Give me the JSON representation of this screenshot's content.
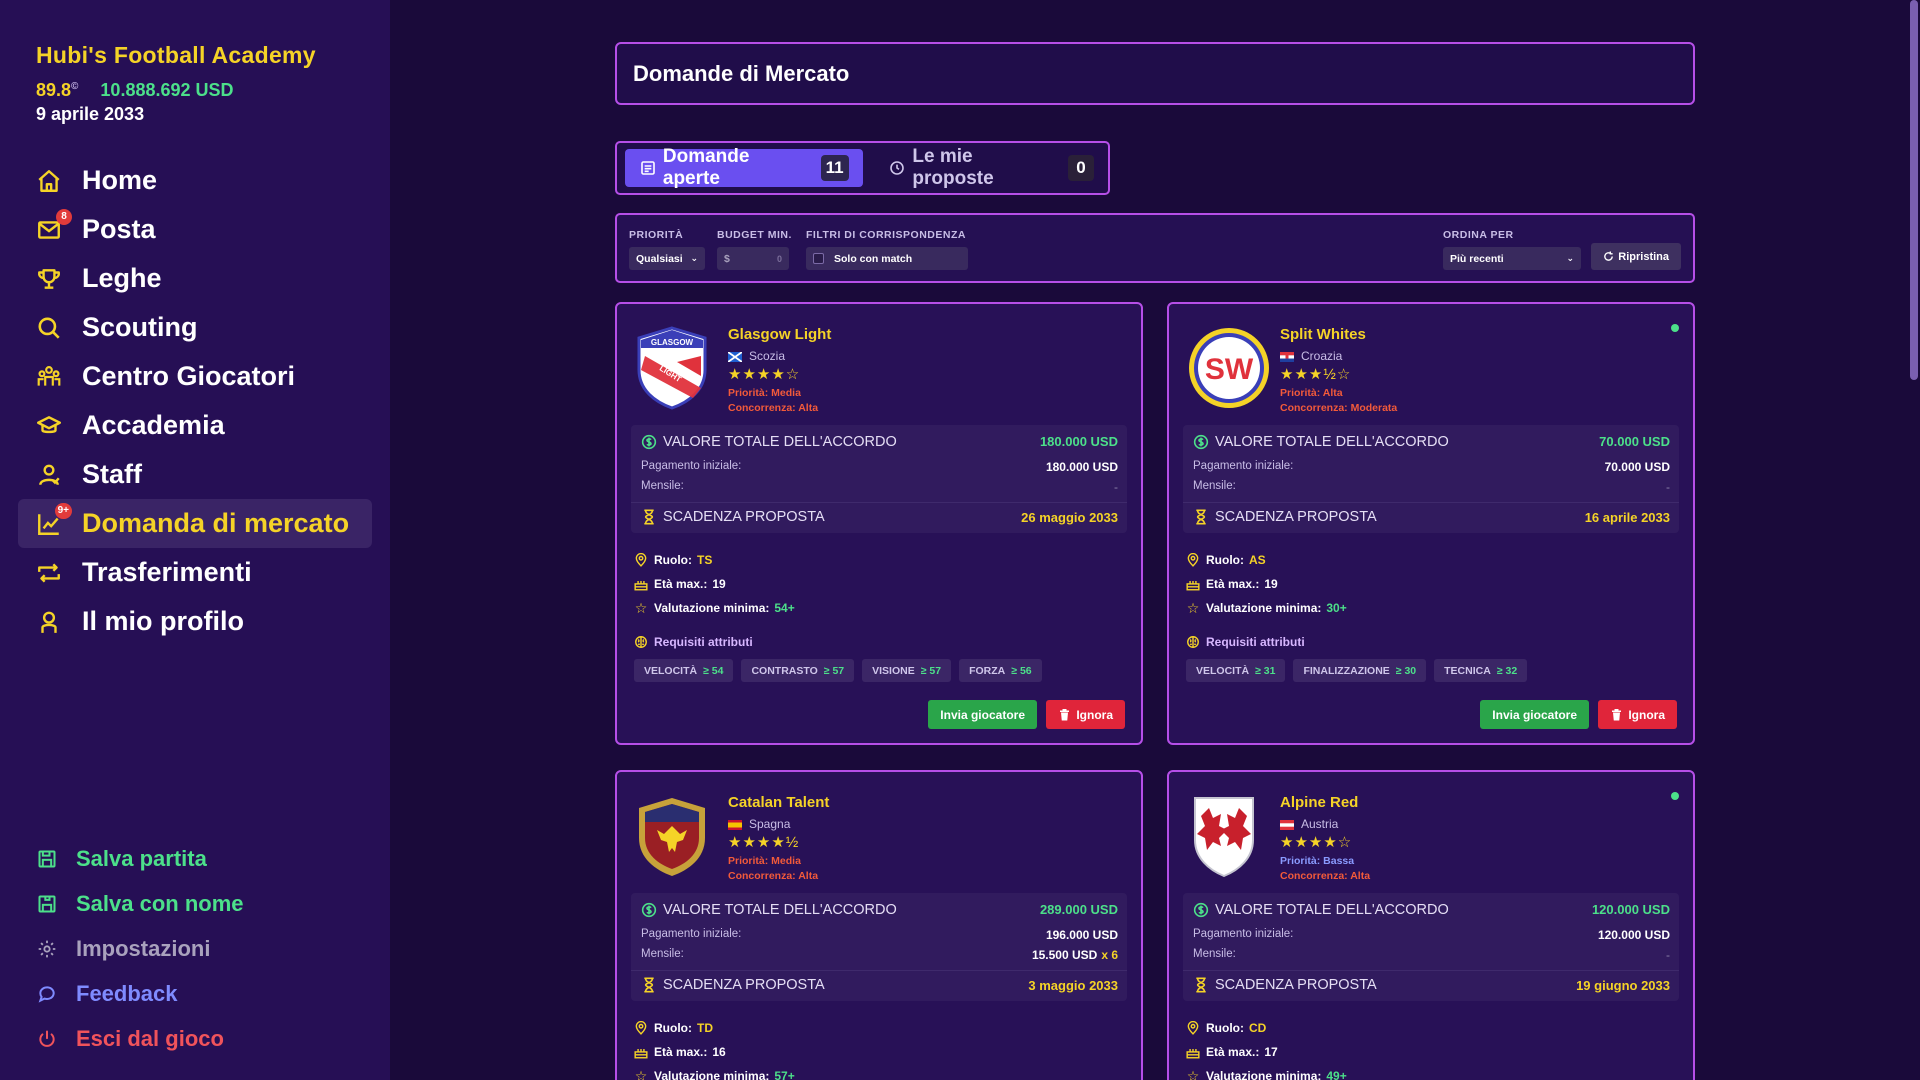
{
  "app": {
    "club_name": "Hubi's Football Academy",
    "rating": "89.8",
    "rating_symbol": "©",
    "balance": "10.888.692 USD",
    "date": "9 aprile 2033"
  },
  "nav": {
    "items": [
      {
        "label": "Home",
        "icon": "home-icon"
      },
      {
        "label": "Posta",
        "icon": "mail-icon",
        "badge": "8"
      },
      {
        "label": "Leghe",
        "icon": "trophy-icon"
      },
      {
        "label": "Scouting",
        "icon": "search-icon"
      },
      {
        "label": "Centro Giocatori",
        "icon": "players-icon"
      },
      {
        "label": "Accademia",
        "icon": "graduation-cap-icon"
      },
      {
        "label": "Staff",
        "icon": "staff-icon"
      },
      {
        "label": "Domanda di mercato",
        "icon": "chart-icon",
        "badge": "9+",
        "active": true
      },
      {
        "label": "Trasferimenti",
        "icon": "transfer-icon"
      },
      {
        "label": "Il mio profilo",
        "icon": "user-icon"
      }
    ],
    "bottom": [
      {
        "label": "Salva partita",
        "icon": "save-icon"
      },
      {
        "label": "Salva con nome",
        "icon": "save-as-icon"
      },
      {
        "label": "Impostazioni",
        "icon": "gear-icon"
      },
      {
        "label": "Feedback",
        "icon": "chat-bubble-icon"
      },
      {
        "label": "Esci dal gioco",
        "icon": "power-icon"
      }
    ]
  },
  "page": {
    "title": "Domande di Mercato"
  },
  "tabs": [
    {
      "label": "Domande aperte",
      "count": "11",
      "icon": "list-icon"
    },
    {
      "label": "Le mie proposte",
      "count": "0",
      "icon": "clock-icon"
    }
  ],
  "filters": {
    "priority_label": "PRIORITÀ",
    "priority_value": "Qualsiasi",
    "budget_label": "BUDGET MIN.",
    "budget_prefix": "$",
    "budget_placeholder": "0",
    "match_label": "FILTRI DI CORRISPONDENZA",
    "match_value": "Solo con match",
    "sort_label": "ORDINA PER",
    "sort_value": "Più recenti",
    "reset_label": "Ripristina"
  },
  "labels": {
    "deal_total": "VALORE TOTALE DELL'ACCORDO",
    "upfront": "Pagamento iniziale:",
    "monthly": "Mensile:",
    "deadline": "SCADENZA PROPOSTA",
    "role": "Ruolo:",
    "max_age": "Età max.:",
    "min_rating": "Valutazione minima:",
    "attr_req": "Requisiti attributi",
    "send": "Invia giocatore",
    "ignore": "Ignora"
  },
  "offers": [
    {
      "club": "Glasgow Light",
      "country": "Scozia",
      "stars": "★★★★☆",
      "priority": "Priorità: Media",
      "competition": "Concorrenza: Alta",
      "total": "180.000 USD",
      "upfront": "180.000 USD",
      "monthly": "-",
      "deadline": "26 maggio 2033",
      "role": "TS",
      "max_age": "19",
      "min_rating": "54+",
      "attrs": [
        {
          "name": "VELOCITÀ",
          "min": "≥ 54"
        },
        {
          "name": "CONTRASTO",
          "min": "≥ 57"
        },
        {
          "name": "VISIONE",
          "min": "≥ 57"
        },
        {
          "name": "FORZA",
          "min": "≥ 56"
        }
      ],
      "online": false,
      "crest_text_top": "GLASGOW",
      "crest_text_diag": "LIGHT"
    },
    {
      "club": "Split Whites",
      "country": "Croazia",
      "stars": "★★★½☆",
      "priority": "Priorità: Alta",
      "competition": "Concorrenza: Moderata",
      "total": "70.000 USD",
      "upfront": "70.000 USD",
      "monthly": "-",
      "deadline": "16 aprile 2033",
      "role": "AS",
      "max_age": "19",
      "min_rating": "30+",
      "attrs": [
        {
          "name": "VELOCITÀ",
          "min": "≥ 31"
        },
        {
          "name": "FINALIZZAZIONE",
          "min": "≥ 30"
        },
        {
          "name": "TECNICA",
          "min": "≥ 32"
        }
      ],
      "online": true,
      "crest_text": "SW"
    },
    {
      "club": "Catalan Talent",
      "country": "Spagna",
      "stars": "★★★★½",
      "priority": "Priorità: Media",
      "competition": "Concorrenza: Alta",
      "total": "289.000 USD",
      "upfront": "196.000 USD",
      "monthly": "15.500 USD",
      "monthly_mult": "x 6",
      "deadline": "3 maggio 2033",
      "role": "TD",
      "max_age": "16",
      "min_rating": "57+",
      "online": false
    },
    {
      "club": "Alpine Red",
      "country": "Austria",
      "stars": "★★★★☆",
      "priority": "Priorità: Bassa",
      "competition": "Concorrenza: Alta",
      "total": "120.000 USD",
      "upfront": "120.000 USD",
      "monthly": "-",
      "deadline": "19 giugno 2033",
      "role": "CD",
      "max_age": "17",
      "min_rating": "49+",
      "online": true
    }
  ],
  "colors": {
    "accent_yellow": "#f5d327",
    "accent_green": "#4ce08a",
    "border_purple": "#b64fe8",
    "bg": "#1a0a3a",
    "sidebar_bg": "#260f55"
  }
}
